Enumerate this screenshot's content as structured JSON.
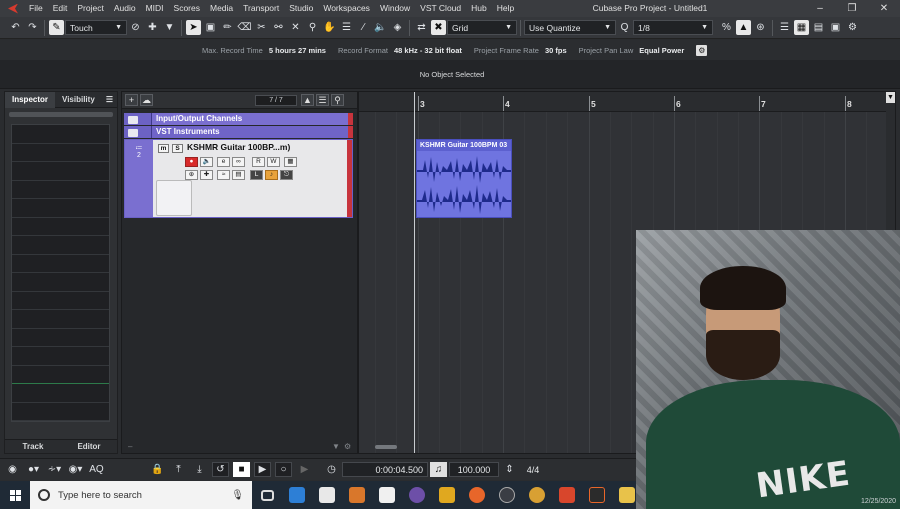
{
  "menu": [
    "File",
    "Edit",
    "Project",
    "Audio",
    "MIDI",
    "Scores",
    "Media",
    "Transport",
    "Studio",
    "Workspaces",
    "Window",
    "VST Cloud",
    "Hub",
    "Help"
  ],
  "window_title": "Cubase Pro Project - Untitled1",
  "toolbar": {
    "automation_mode": "Touch",
    "snap_type": "Grid",
    "quantize_mode": "Use Quantize",
    "quantize_value": "1/8"
  },
  "info": {
    "max_record_time_label": "Max. Record Time",
    "max_record_time": "5 hours 27 mins",
    "record_format_label": "Record Format",
    "record_format": "48 kHz - 32 bit float",
    "frame_rate_label": "Project Frame Rate",
    "frame_rate": "30 fps",
    "pan_law_label": "Project Pan Law",
    "pan_law": "Equal Power"
  },
  "status": "No Object Selected",
  "inspector": {
    "tabs": [
      "Inspector",
      "Visibility"
    ],
    "bottom_tabs": [
      "Track",
      "Editor"
    ]
  },
  "tracklist": {
    "count": "7 / 7",
    "tracks": [
      {
        "name": "Input/Output Channels"
      },
      {
        "name": "VST Instruments"
      },
      {
        "name": "KSHMR Guitar 100BP...m)",
        "number": "2"
      }
    ]
  },
  "ruler": {
    "bars": [
      "3",
      "4",
      "5",
      "6",
      "7",
      "8"
    ]
  },
  "event": {
    "title": "KSHMR Guitar 100BPM 03"
  },
  "transport": {
    "time": "0:00:04.500",
    "tempo": "100.000",
    "signature": "4/4"
  },
  "taskbar": {
    "search_placeholder": "Type here to search"
  },
  "webcam": {
    "date": "12/25/2020",
    "shirt_text": "NIKE"
  },
  "colors": {
    "track": "#7a6fd0",
    "event": "#6f74e0",
    "record": "#d82a2a"
  }
}
